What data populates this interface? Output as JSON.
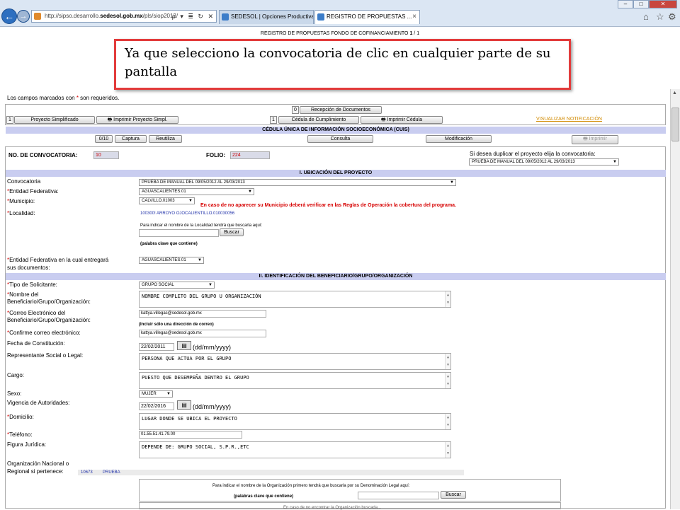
{
  "browser": {
    "url_prefix": "http://sipso.desarrollo.",
    "url_domain": "sedesol.gob.mx",
    "url_suffix": "/pls/siop2012/",
    "url_tools": "ρ ▾ ≣ ↻ ✕",
    "tabs": [
      {
        "label": "SEDESOL | Opciones Productivas"
      },
      {
        "label": "REGISTRO DE PROPUESTAS ..."
      }
    ],
    "tab_close": "×"
  },
  "page_title_prefix": "REGISTRO DE PROPUESTAS FONDO DE COFINANCIAMIENTO ",
  "page_title_num": "1",
  "page_title_suffix": " / 1",
  "callout_text": "Ya que selecciono la convocatoria de clic en cualquier parte de su pantalla",
  "required_note": {
    "before": "Los campos marcados con ",
    "star": "*",
    "after": " son requeridos."
  },
  "toolbar": {
    "recepcion_count": "0",
    "recepcion_label": "Recepción de Documentos",
    "simplificado_count": "1",
    "simplificado_label": "Proyecto Simplificado",
    "imprimir_simpl_label": "Imprimir Proyecto Simpl.",
    "cumplimiento_count": "1",
    "cumplimiento_label": "Cédula de Cumplimiento",
    "imprimir_cedula_label": "Imprimir Cédula",
    "visualizar_label": "VISUALIZAR NOTIFICACIÓN"
  },
  "cuis_title": "CÉDULA ÚNICA DE INFORMACIÓN SOCIOECONÓMICA (CUIS)",
  "cuis_buttons": {
    "count": "0/10",
    "captura": "Captura",
    "reutiliza": "Reutiliza",
    "consulta": "Consulta",
    "modificacion": "Modificación",
    "imprimir": "Imprimir"
  },
  "header_fields": {
    "convocatoria_label": "NO. DE CONVOCATORIA:",
    "convocatoria_value": "10",
    "folio_label": "FOLIO:",
    "folio_value": "224",
    "duplicar_label": "Si desea duplicar el proyecto elija la convocatoria:",
    "duplicar_value": "PRUEBA DE MANUAL DEL 09/05/2012 AL 29/03/2013"
  },
  "section1": {
    "title": "I. UBICACIÓN DEL PROYECTO",
    "convocatoria_label": "Convocatoria",
    "convocatoria_value": "PRUEBA DE MANUAL DEL 09/05/2012 AL 29/03/2013",
    "entidad_label": "Entidad Federativa:",
    "entidad_value": "AGUASCALIENTES.01",
    "municipio_label": "Municipio:",
    "municipio_value": "CALVILLO.01003",
    "municipio_warning": "En caso de no aparecer su Municipio deberá verificar en las Reglas de Operación la cobertura del programa.",
    "localidad_label": "Localidad:",
    "localidad_value": "100300! ARROYO OJOCALIENTILLO.010030056",
    "localidad_hint": "Para indicar el nombre de la Localidad tendrá que buscarla aquí:",
    "buscar_label": "Buscar",
    "palabra_clave": "(palabra clave que contiene)",
    "entidad_entrega_label_1": "Entidad Federativa en la cual entregará",
    "entidad_entrega_label_2": "sus documentos:",
    "entidad_entrega_value": "AGUASCALIENTES.01"
  },
  "section2": {
    "title": "II. IDENTIFICACIÓN DEL BENEFICIARIO/GRUPO/ORGANIZACIÓN",
    "tipo_label": "Tipo de Solicitante:",
    "tipo_value": "GRUPO SOCIAL",
    "nombre_label_1": "Nombre del",
    "nombre_label_2": "Beneficiario/Grupo/Organización:",
    "nombre_value": "NOMBRE COMPLETO DEL GRUPO U ORGANIZACIÓN",
    "correo_label_1": "Correo Electrónico del",
    "correo_label_2": "Beneficiario/Grupo/Organización:",
    "correo_value": "kattya.villegas@sedesol.gob.mx",
    "correo_hint": "(Incluir sólo una dirección de correo)",
    "confirme_label": "Confirme correo electrónico:",
    "confirme_value": "kattya.villegas@sedesol.gob.mx",
    "fecha_label": "Fecha de Constitución:",
    "fecha_value": "22/02/2011",
    "fecha_format": "(dd/mm/yyyy)",
    "representante_label": "Representante Social o Legal:",
    "representante_value": "PERSONA QUE ACTUA POR EL GRUPO",
    "cargo_label": "Cargo:",
    "cargo_value": "PUESTO QUE DESEMPEÑA DENTRO EL GRUPO",
    "sexo_label": "Sexo:",
    "sexo_value": "MUJER",
    "vigencia_label": "Vigencia de Autoridades:",
    "vigencia_value": "22/02/2016",
    "vigencia_format": "(dd/mm/yyyy)",
    "domicilio_label": "Domicilio:",
    "domicilio_value": "LUGAR DONDE SE UBICA EL PROYECTO",
    "telefono_label": "Teléfono:",
    "telefono_value": "01.55.51.41.79.00",
    "figura_label": "Figura Jurídica:",
    "figura_value": "DEPENDE DE: GRUPO SOCIAL, S.P.R.,ETC",
    "org_label_1": "Organización Nacional o",
    "org_label_2": "Regional si pertenece:",
    "org_code": "10673",
    "org_name": "PRUEBA",
    "org_hint": "Para indicar el nombre de la Organización primero tendrá que buscarla por su Denominación Legal aquí:",
    "org_clave": "(palabras clave que contiene)",
    "org_buscar": "Buscar",
    "org_footer": "En caso de no encontrar la Organización buscada..."
  },
  "star": "*"
}
